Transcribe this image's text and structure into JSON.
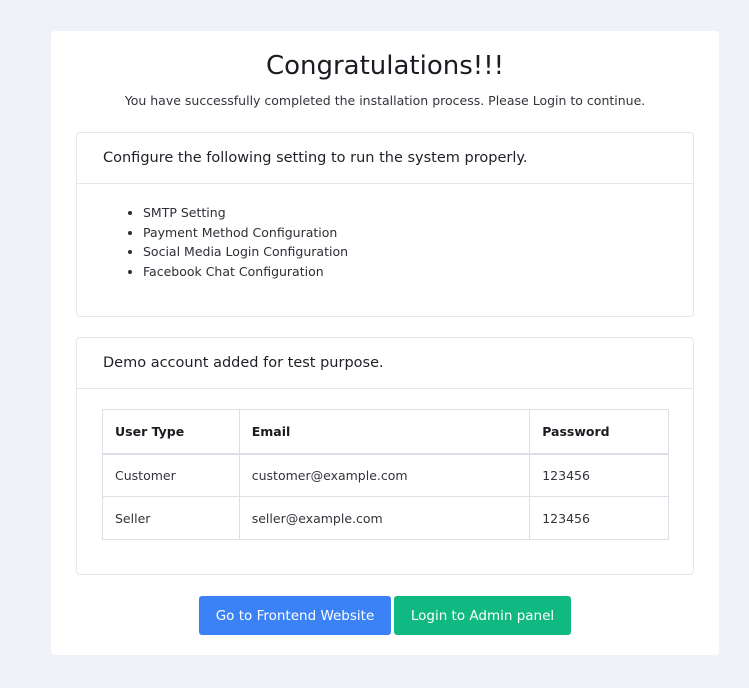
{
  "header": {
    "title": "Congratulations!!!",
    "subtitle": "You have successfully completed the installation process. Please Login to continue."
  },
  "config_panel": {
    "heading": "Configure the following setting to run the system properly.",
    "items": [
      "SMTP Setting",
      "Payment Method Configuration",
      "Social Media Login Configuration",
      "Facebook Chat Configuration"
    ]
  },
  "demo_panel": {
    "heading": "Demo account added for test purpose.",
    "columns": [
      "User Type",
      "Email",
      "Password"
    ],
    "rows": [
      [
        "Customer",
        "customer@example.com",
        "123456"
      ],
      [
        "Seller",
        "seller@example.com",
        "123456"
      ]
    ]
  },
  "actions": {
    "frontend_label": "Go to Frontend Website",
    "admin_label": "Login to Admin panel"
  },
  "colors": {
    "background": "#f1f2f7",
    "primary": "#3b82f6",
    "success": "#10b981"
  }
}
